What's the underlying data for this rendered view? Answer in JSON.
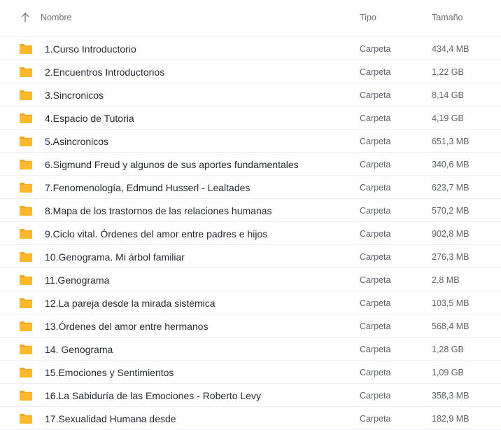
{
  "header": {
    "sort_icon": "arrow-up-icon",
    "name_label": "Nombre",
    "type_label": "Tipo",
    "size_label": "Tamaño"
  },
  "colors": {
    "folder": "#fcb929",
    "folder_tab": "#f5a623"
  },
  "items": [
    {
      "icon": "folder-icon",
      "name": "1.Curso Introductorio",
      "type": "Carpeta",
      "size": "434,4 MB"
    },
    {
      "icon": "folder-icon",
      "name": "2.Encuentros Introductorios",
      "type": "Carpeta",
      "size": "1,22 GB"
    },
    {
      "icon": "folder-icon",
      "name": "3.Sincronicos",
      "type": "Carpeta",
      "size": "8,14 GB"
    },
    {
      "icon": "folder-icon",
      "name": "4.Espacio de Tutoria",
      "type": "Carpeta",
      "size": "4,19 GB"
    },
    {
      "icon": "folder-icon",
      "name": "5.Asincronicos",
      "type": "Carpeta",
      "size": "651,3 MB"
    },
    {
      "icon": "folder-icon",
      "name": "6.Sigmund Freud y algunos de sus aportes fundamentales",
      "type": "Carpeta",
      "size": "340,6 MB"
    },
    {
      "icon": "folder-icon",
      "name": "7.Fenomenología, Edmund Husserl - Lealtades",
      "type": "Carpeta",
      "size": "623,7 MB"
    },
    {
      "icon": "folder-icon",
      "name": "8.Mapa de los trastornos de las relaciones humanas",
      "type": "Carpeta",
      "size": "570,2 MB"
    },
    {
      "icon": "folder-icon",
      "name": "9.Ciclo vital. Órdenes del amor entre padres e hijos",
      "type": "Carpeta",
      "size": "902,8 MB"
    },
    {
      "icon": "folder-icon",
      "name": "10.Genograma. Mi árbol familiar",
      "type": "Carpeta",
      "size": "276,3 MB"
    },
    {
      "icon": "folder-icon",
      "name": "11.Genograma",
      "type": "Carpeta",
      "size": "2,8 MB"
    },
    {
      "icon": "folder-icon",
      "name": "12.La pareja desde la mirada sistémica",
      "type": "Carpeta",
      "size": "103,5 MB"
    },
    {
      "icon": "folder-icon",
      "name": "13.Órdenes del amor entre hermanos",
      "type": "Carpeta",
      "size": "568,4 MB"
    },
    {
      "icon": "folder-icon",
      "name": "14. Genograma",
      "type": "Carpeta",
      "size": "1,28 GB"
    },
    {
      "icon": "folder-icon",
      "name": "15.Emociones y Sentimientos",
      "type": "Carpeta",
      "size": "1,09 GB"
    },
    {
      "icon": "folder-icon",
      "name": "16.La Sabiduría de las Emociones - Roberto Levy",
      "type": "Carpeta",
      "size": "358,3 MB"
    },
    {
      "icon": "folder-icon",
      "name": "17.Sexualidad Humana desde",
      "type": "Carpeta",
      "size": "182,9 MB"
    }
  ]
}
